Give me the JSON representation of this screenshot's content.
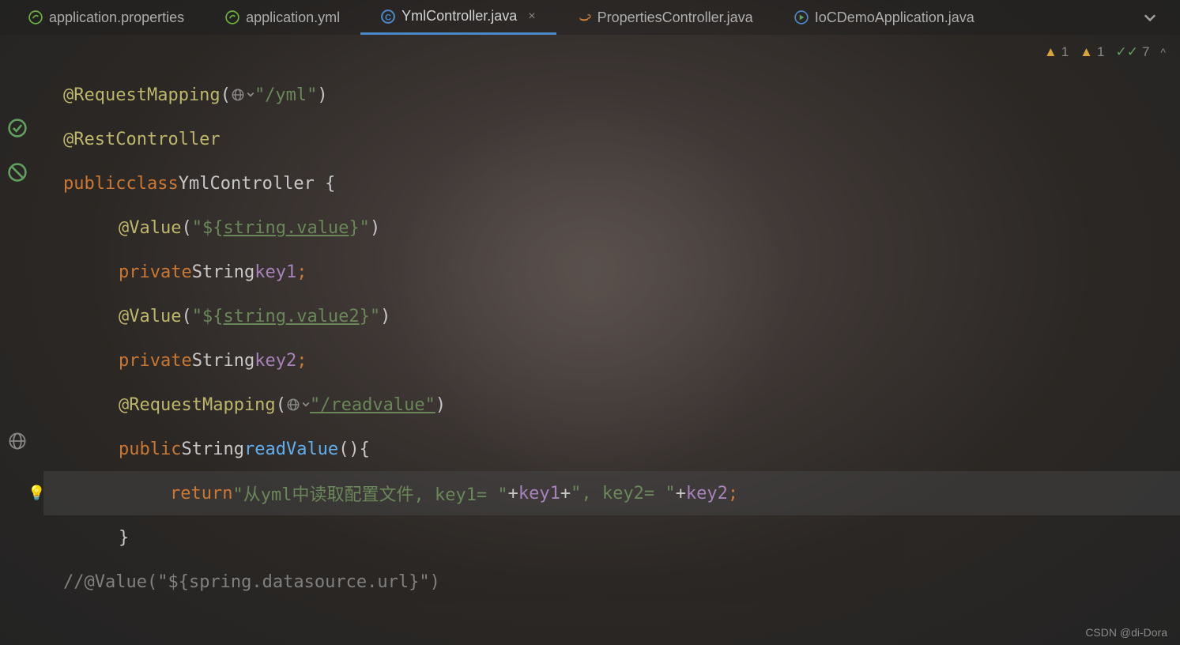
{
  "tabs": [
    {
      "label": "application.properties",
      "icon": "spring",
      "active": false
    },
    {
      "label": "application.yml",
      "icon": "spring",
      "active": false
    },
    {
      "label": "YmlController.java",
      "icon": "class",
      "active": true
    },
    {
      "label": "PropertiesController.java",
      "icon": "java",
      "active": false
    },
    {
      "label": "IoCDemoApplication.java",
      "icon": "run",
      "active": false
    }
  ],
  "inspections": {
    "warn1": "1",
    "warn2": "1",
    "ok": "7"
  },
  "code": {
    "anno_requestmapping": "@RequestMapping",
    "str_yml": "\"/yml\"",
    "anno_restcontroller": "@RestController",
    "kw_public": "public",
    "kw_class": "class",
    "cls_name": "YmlController",
    "brace_open": " {",
    "anno_value": "@Value",
    "str_val1_open": "\"${",
    "str_val1_mid": "string.value",
    "str_val1_close": "}\"",
    "kw_private": "private",
    "type_string": "String",
    "ident_key1": "key1",
    "str_val2_open": "\"${",
    "str_val2_mid": "string.value2",
    "str_val2_close": "}\"",
    "ident_key2": "key2",
    "str_readvalue": "\"/readvalue\"",
    "method_readvalue": "readValue",
    "method_sig_end": "(){",
    "kw_return": "return",
    "str_ret1": "\"从yml中读取配置文件, key1= \"",
    "tok_plus": "+",
    "str_ret2": "\", key2= \"",
    "brace_close": "}",
    "comment_marker": "//",
    "comment_value": "@Value(\"${spring.datasource.url}\")",
    "semi": ";",
    "paren_open": "(",
    "paren_close": ")"
  },
  "watermark": "CSDN @di-Dora"
}
